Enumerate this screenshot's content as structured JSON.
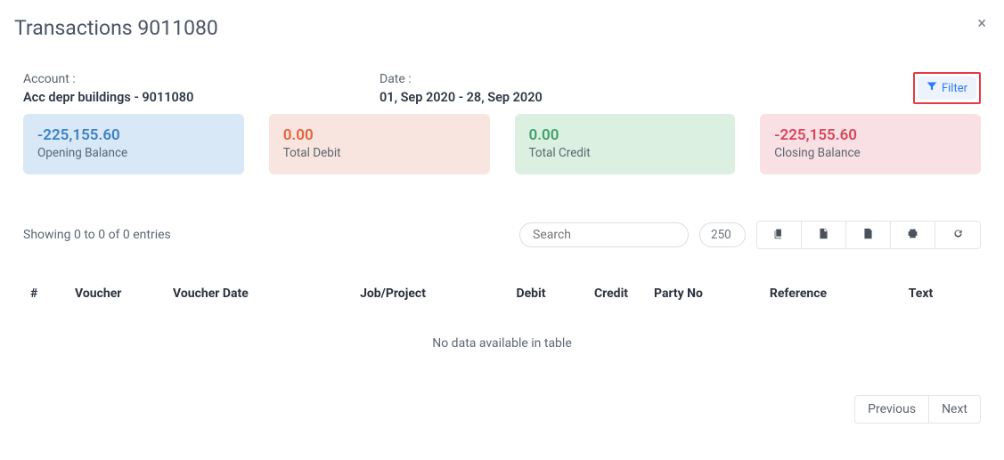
{
  "title": "Transactions 9011080",
  "close_glyph": "×",
  "meta": {
    "account_label": "Account :",
    "account_value": "Acc depr buildings - 9011080",
    "date_label": "Date :",
    "date_value": "01, Sep 2020 - 28, Sep 2020"
  },
  "filter": {
    "label": "Filter"
  },
  "cards": {
    "opening": {
      "value": "-225,155.60",
      "label": "Opening Balance"
    },
    "debit": {
      "value": "0.00",
      "label": "Total Debit"
    },
    "credit": {
      "value": "0.00",
      "label": "Total Credit"
    },
    "closing": {
      "value": "-225,155.60",
      "label": "Closing Balance"
    }
  },
  "toolbar": {
    "showing": "Showing 0 to 0 of 0 entries",
    "search_placeholder": "Search",
    "page_size": "250"
  },
  "table": {
    "columns": {
      "num": "#",
      "voucher": "Voucher",
      "voucher_date": "Voucher Date",
      "job_project": "Job/Project",
      "debit": "Debit",
      "credit": "Credit",
      "party_no": "Party No",
      "reference": "Reference",
      "text": "Text"
    },
    "empty": "No data available in table"
  },
  "pager": {
    "previous": "Previous",
    "next": "Next"
  }
}
